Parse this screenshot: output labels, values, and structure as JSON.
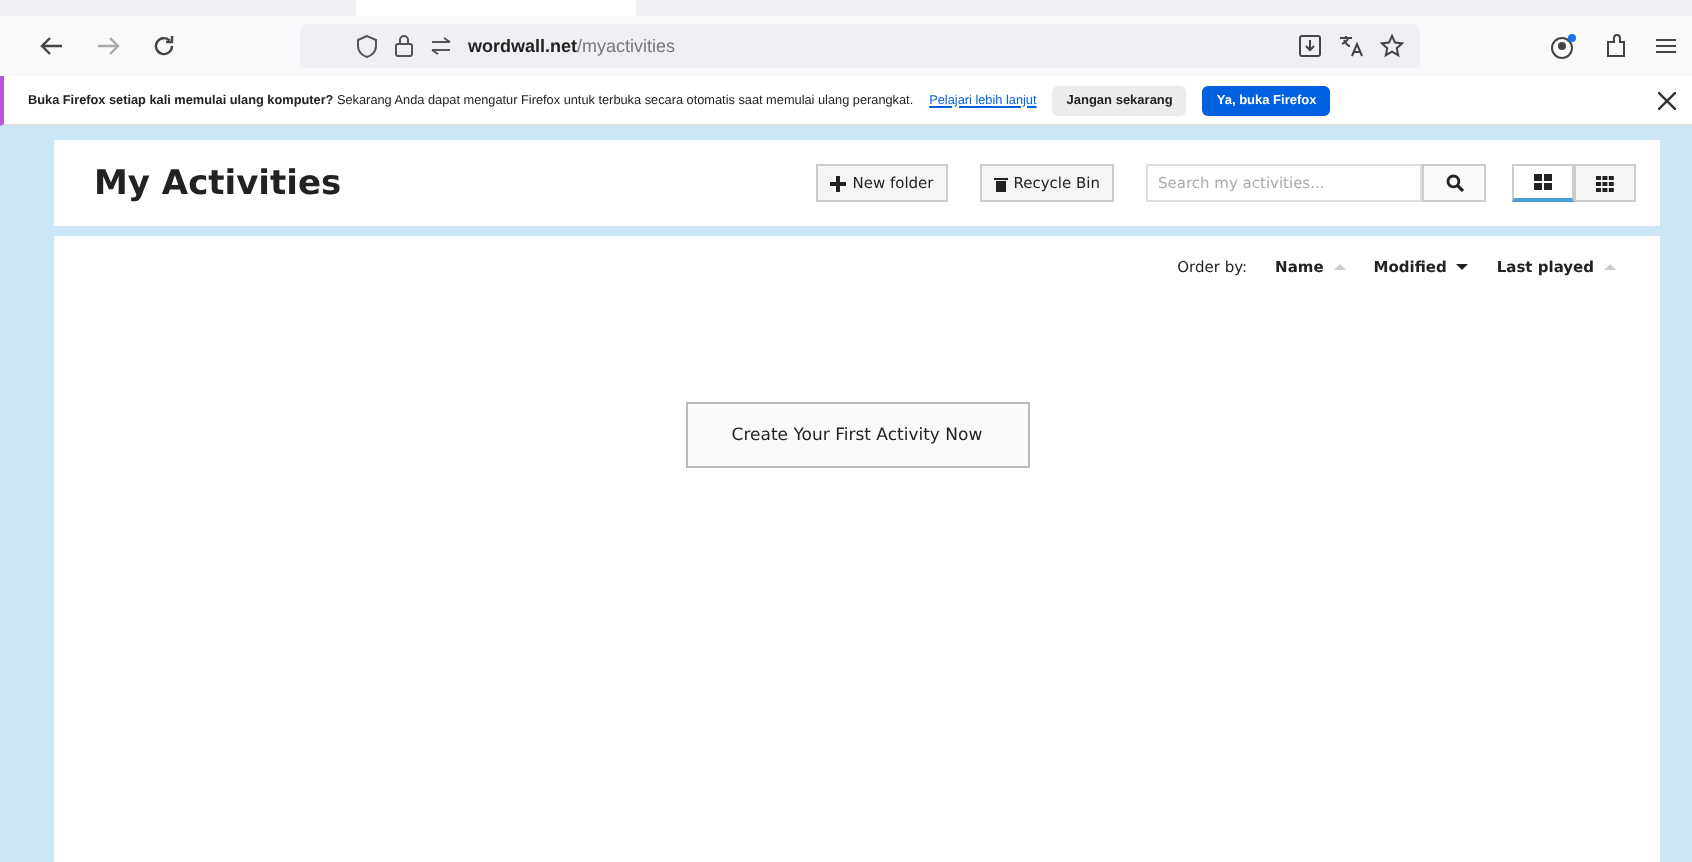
{
  "browser": {
    "url_host": "wordwall.net",
    "url_path": "/myactivities"
  },
  "notification": {
    "bold": "Buka Firefox setiap kali memulai ulang komputer?",
    "text": "Sekarang Anda dapat mengatur Firefox untuk terbuka secara otomatis saat memulai ulang perangkat.",
    "link": "Pelajari lebih lanjut",
    "buttons": [
      {
        "label": "Jangan sekarang",
        "kind": "secondary"
      },
      {
        "label": "Ya, buka Firefox",
        "kind": "primary"
      }
    ]
  },
  "page": {
    "title": "My Activities",
    "new_folder": "New folder",
    "recycle_bin": "Recycle Bin",
    "search": {
      "placeholder": "Search my activities..."
    },
    "views": [
      {
        "kind": "large",
        "selected": true
      },
      {
        "kind": "small",
        "selected": false
      }
    ],
    "order_label": "Order by:",
    "order": [
      {
        "label": "Name",
        "selected": false
      },
      {
        "label": "Modified",
        "selected": true
      },
      {
        "label": "Last played",
        "selected": false
      }
    ],
    "create_button": "Create Your First Activity Now"
  }
}
